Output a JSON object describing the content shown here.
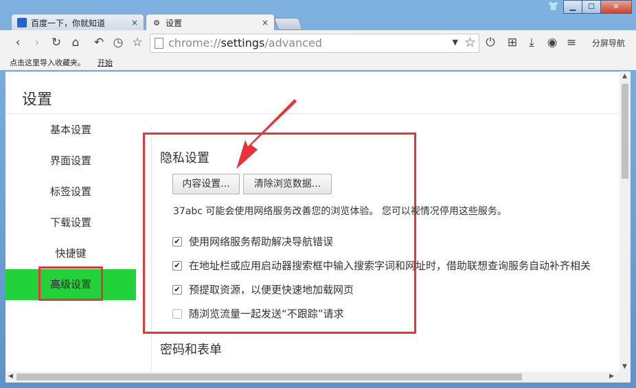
{
  "browser": {
    "tabs": [
      {
        "label": "百度一下，你就知道",
        "close": "×"
      },
      {
        "label": "设置",
        "close": "×"
      }
    ],
    "address": {
      "scheme": "chrome://",
      "host": "settings",
      "path": "/advanced"
    },
    "toolbar_right_label": "分屏导航",
    "bookmarks_hint": "点击这里导入收藏夹。",
    "bookmarks_start": "开始"
  },
  "settings": {
    "page_title": "设置",
    "nav": [
      "基本设置",
      "界面设置",
      "标签设置",
      "下载设置",
      "快捷键",
      "高级设置"
    ],
    "active_nav": "高级设置",
    "privacy": {
      "heading": "隐私设置",
      "content_button": "内容设置...",
      "clear_button": "清除浏览数据...",
      "description": "37abc 可能会使用网络服务改善您的浏览体验。 您可以视情况停用这些服务。",
      "options": [
        {
          "label": "使用网络服务帮助解决导航错误",
          "checked": true
        },
        {
          "label": "在地址栏或应用启动器搜索框中输入搜索字词和网址时，借助联想查询服务自动补齐相关",
          "checked": true
        },
        {
          "label": "预提取资源，以便更快速地加载网页",
          "checked": true
        },
        {
          "label": "随浏览流量一起发送“不跟踪”请求",
          "checked": false
        }
      ]
    },
    "password_heading": "密码和表单"
  },
  "colors": {
    "highlight": "#e8333c",
    "active_nav": "#21d23a"
  }
}
